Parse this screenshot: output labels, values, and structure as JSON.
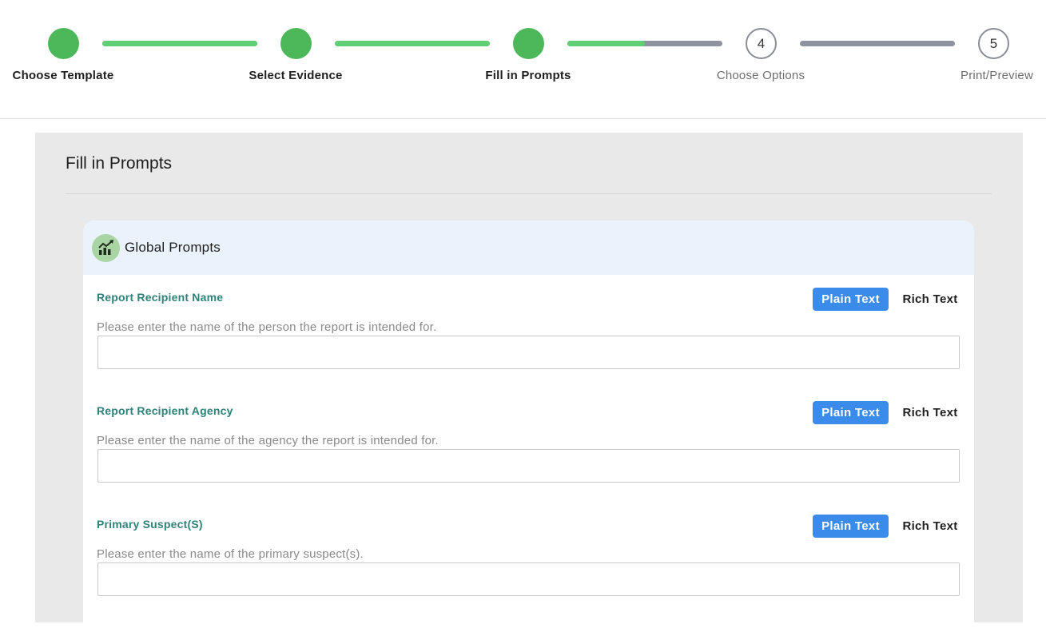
{
  "stepper": {
    "steps": [
      {
        "number": "",
        "label": "Choose Template",
        "status": "done"
      },
      {
        "number": "",
        "label": "Select Evidence",
        "status": "done"
      },
      {
        "number": "",
        "label": "Fill in Prompts",
        "status": "done"
      },
      {
        "number": "4",
        "label": "Choose Options",
        "status": "todo"
      },
      {
        "number": "5",
        "label": "Print/Preview",
        "status": "todo"
      }
    ],
    "connector_progress": [
      1.0,
      1.0,
      0.5,
      0.0
    ],
    "colors": {
      "done": "#4cb85a",
      "progress": "#5fcf73",
      "track": "#8f93a0"
    }
  },
  "panel": {
    "title": "Fill in Prompts"
  },
  "card": {
    "icon": "growth-chart-icon",
    "title": "Global Prompts",
    "prompts": [
      {
        "label": "Report Recipient Name",
        "help": "Please enter the name of the person the report is intended for.",
        "value": "",
        "plain_label": "Plain Text",
        "rich_label": "Rich Text"
      },
      {
        "label": "Report Recipient Agency",
        "help": "Please enter the name of the agency the report is intended for.",
        "value": "",
        "plain_label": "Plain Text",
        "rich_label": "Rich Text"
      },
      {
        "label": "Primary Suspect(S)",
        "help": "Please enter the name of the primary suspect(s).",
        "value": "",
        "plain_label": "Plain Text",
        "rich_label": "Rich Text"
      }
    ]
  }
}
